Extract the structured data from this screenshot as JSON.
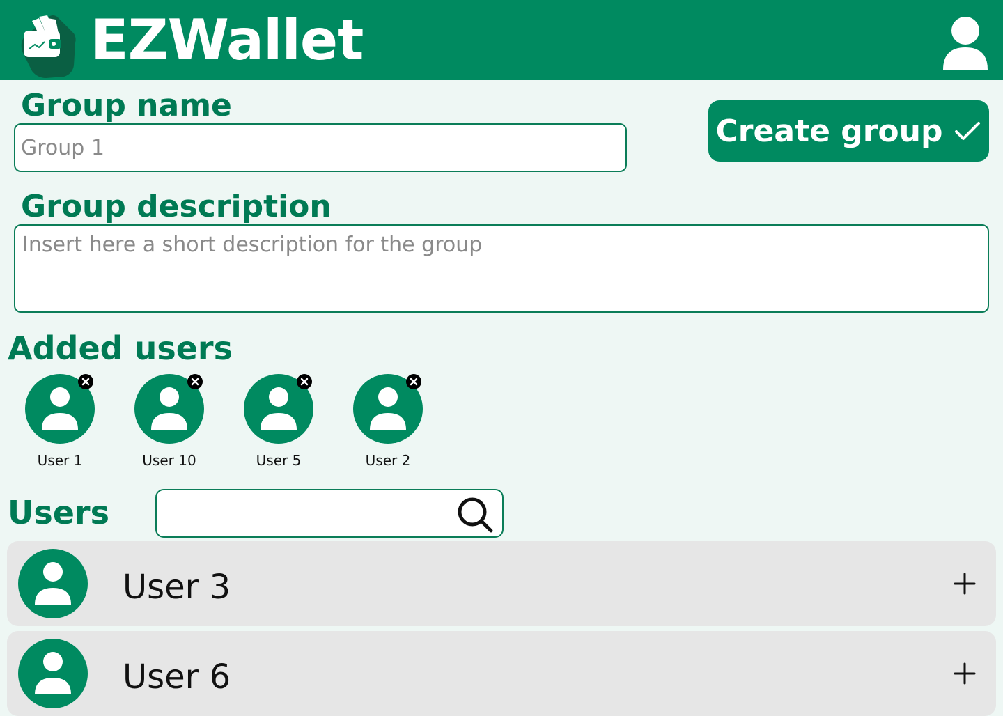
{
  "app": {
    "title": "EZWallet",
    "brand_color": "#008a60",
    "background": "#eef7f4"
  },
  "header": {
    "logo_icon": "wallet-logo-icon",
    "profile_icon": "user-profile-icon"
  },
  "form": {
    "group_name_label": "Group name",
    "group_name_placeholder": "Group 1",
    "group_description_label": "Group description",
    "group_description_placeholder": "Insert here a short description for the group",
    "create_button_label": "Create group",
    "create_button_icon": "checkmark-icon"
  },
  "added_users": {
    "label": "Added users",
    "items": [
      {
        "name": "User 1"
      },
      {
        "name": "User 10"
      },
      {
        "name": "User 5"
      },
      {
        "name": "User 2"
      }
    ]
  },
  "users": {
    "label": "Users",
    "search_icon": "search-icon",
    "items": [
      {
        "name": "User 3"
      },
      {
        "name": "User 6"
      }
    ]
  }
}
